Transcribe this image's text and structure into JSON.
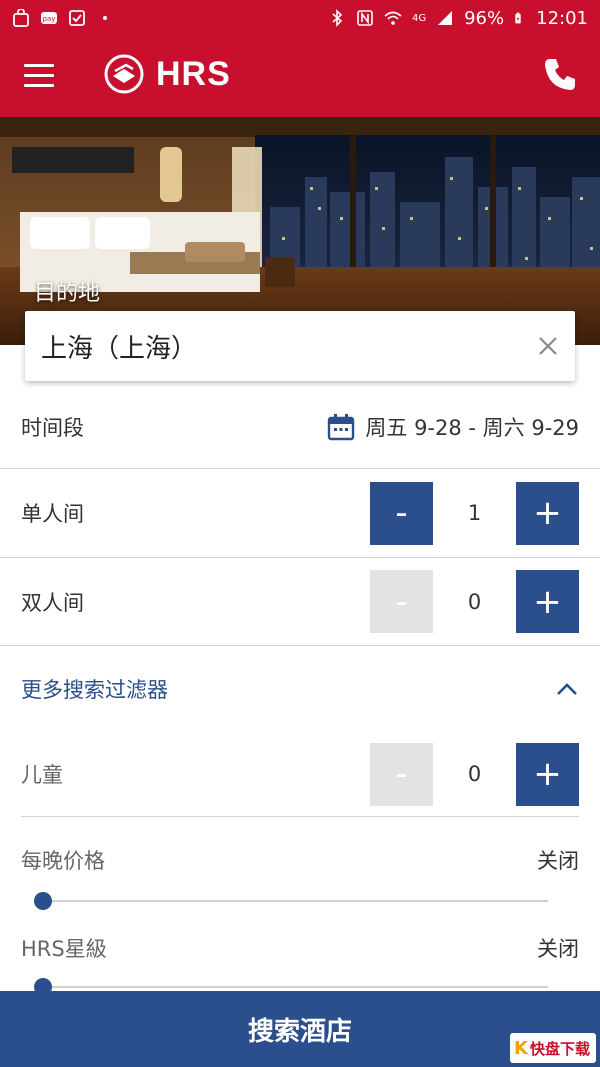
{
  "status_bar": {
    "battery": "96%",
    "time": "12:01",
    "network": "4G"
  },
  "app": {
    "brand": "HRS",
    "color_primary": "#c8102e",
    "color_accent": "#2b4f8c"
  },
  "destination": {
    "label": "目的地",
    "value": "上海（上海）"
  },
  "dates": {
    "label": "时间段",
    "value": "周五 9-28 - 周六 9-29"
  },
  "rooms": {
    "single": {
      "label": "单人间",
      "minus": "-",
      "plus": "+",
      "count": "1"
    },
    "double": {
      "label": "双人间",
      "minus": "-",
      "plus": "+",
      "count": "0"
    }
  },
  "more_filters": {
    "label": "更多搜索过滤器",
    "children": {
      "label": "儿童",
      "minus": "-",
      "plus": "+",
      "count": "0"
    },
    "price": {
      "label": "每晚价格",
      "state": "关闭",
      "level": 0
    },
    "stars": {
      "label": "HRS星級",
      "state": "关闭",
      "level": 0
    }
  },
  "search_button": {
    "label": "搜索酒店"
  },
  "watermark": {
    "k": "K",
    "text": "快盘下载"
  }
}
